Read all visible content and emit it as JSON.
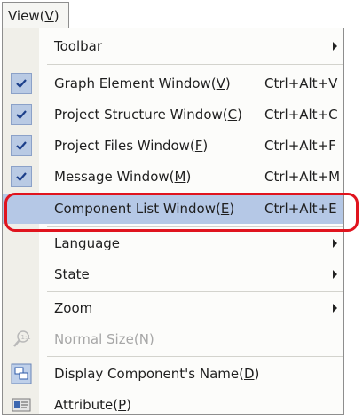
{
  "menubar": {
    "label": "View(",
    "mnemonic": "V",
    "suffix": ")"
  },
  "menu": {
    "items": [
      {
        "label": "Toolbar",
        "submenu": true
      },
      {
        "label": "Graph Element Window(",
        "mnemonic": "V",
        "suffix": ")",
        "shortcut": "Ctrl+Alt+V",
        "checked": true
      },
      {
        "label": "Project Structure Window(",
        "mnemonic": "C",
        "suffix": ")",
        "shortcut": "Ctrl+Alt+C",
        "checked": true
      },
      {
        "label": "Project Files Window(",
        "mnemonic": "F",
        "suffix": ")",
        "shortcut": "Ctrl+Alt+F",
        "checked": true
      },
      {
        "label": "Message Window(",
        "mnemonic": "M",
        "suffix": ")",
        "shortcut": "Ctrl+Alt+M",
        "checked": true
      },
      {
        "label": "Component List Window(",
        "mnemonic": "E",
        "suffix": ")",
        "shortcut": "Ctrl+Alt+E",
        "selected": true
      },
      {
        "label": "Language",
        "submenu": true
      },
      {
        "label": "State",
        "submenu": true
      },
      {
        "label": "Zoom",
        "submenu": true
      },
      {
        "label": "Normal Size(",
        "mnemonic": "N",
        "suffix": ")",
        "disabled": true,
        "icon": "zoom-magnifier-icon"
      },
      {
        "label": "Display Component's Name(",
        "mnemonic": "D",
        "suffix": ")",
        "icon": "component-name-icon"
      },
      {
        "label": "Attribute(",
        "mnemonic": "P",
        "suffix": ")",
        "icon": "attribute-icon"
      }
    ]
  },
  "colors": {
    "highlight": "#b5c8e6",
    "check_background": "#b9cae4",
    "callout_border": "#e0141e",
    "gutter": "#f0efe9"
  }
}
